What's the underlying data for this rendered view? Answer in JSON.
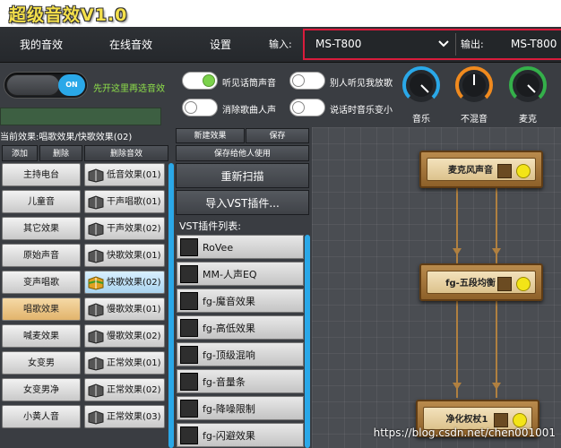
{
  "title": "超级音效V1.0",
  "nav": {
    "my_effects": "我的音效",
    "online_effects": "在线音效",
    "settings": "设置"
  },
  "io": {
    "input_label": "输入:",
    "input_device": "MS-T800",
    "output_label": "输出:",
    "output_device": "MS-T800"
  },
  "master_toggle": {
    "state": "ON"
  },
  "hint": "先开这里再选音效",
  "switches": [
    {
      "label": "听见话筒声音",
      "on": true
    },
    {
      "label": "别人听见我放歌",
      "on": false
    },
    {
      "label": "消除歌曲人声",
      "on": false
    },
    {
      "label": "说话时音乐变小",
      "on": false
    }
  ],
  "gauges": [
    {
      "label": "音乐",
      "color": "#2aa8e8"
    },
    {
      "label": "不混音",
      "color": "#f08a1e"
    },
    {
      "label": "麦克",
      "color": "#34b04a"
    }
  ],
  "current_effect": "当前效果:唱歌效果/快歌效果(02)",
  "list_buttons": {
    "add": "添加",
    "delete": "删除",
    "remove_effect": "删除音效"
  },
  "action_buttons": {
    "new_effect": "新建效果",
    "save": "保存",
    "save_for_others": "保存给他人使用",
    "rescan": "重新扫描",
    "import_vst": "导入VST插件..."
  },
  "categories": [
    "主持电台",
    "儿童音",
    "其它效果",
    "原始声音",
    "变声唱歌",
    "唱歌效果",
    "喊麦效果",
    "女变男",
    "女变男净",
    "小黄人音"
  ],
  "effects": [
    "低音效果(01)",
    "干声唱歌(01)",
    "干声效果(02)",
    "快歌效果(01)",
    "快歌效果(02)",
    "慢歌效果(01)",
    "慢歌效果(02)",
    "正常效果(01)",
    "正常效果(02)",
    "正常效果(03)"
  ],
  "vst_title": "VST插件列表:",
  "vst_plugins": [
    "RoVee",
    "MM-人声EQ",
    "fg-魔音效果",
    "fg-高低效果",
    "fg-顶级混响",
    "fg-音量条",
    "fg-降噪限制",
    "fg-闪避效果"
  ],
  "chain_nodes": [
    "麦克风声音",
    "fg-五段均衡",
    "净化权杖1"
  ],
  "watermark": "https://blog.csdn.net/chen001001"
}
